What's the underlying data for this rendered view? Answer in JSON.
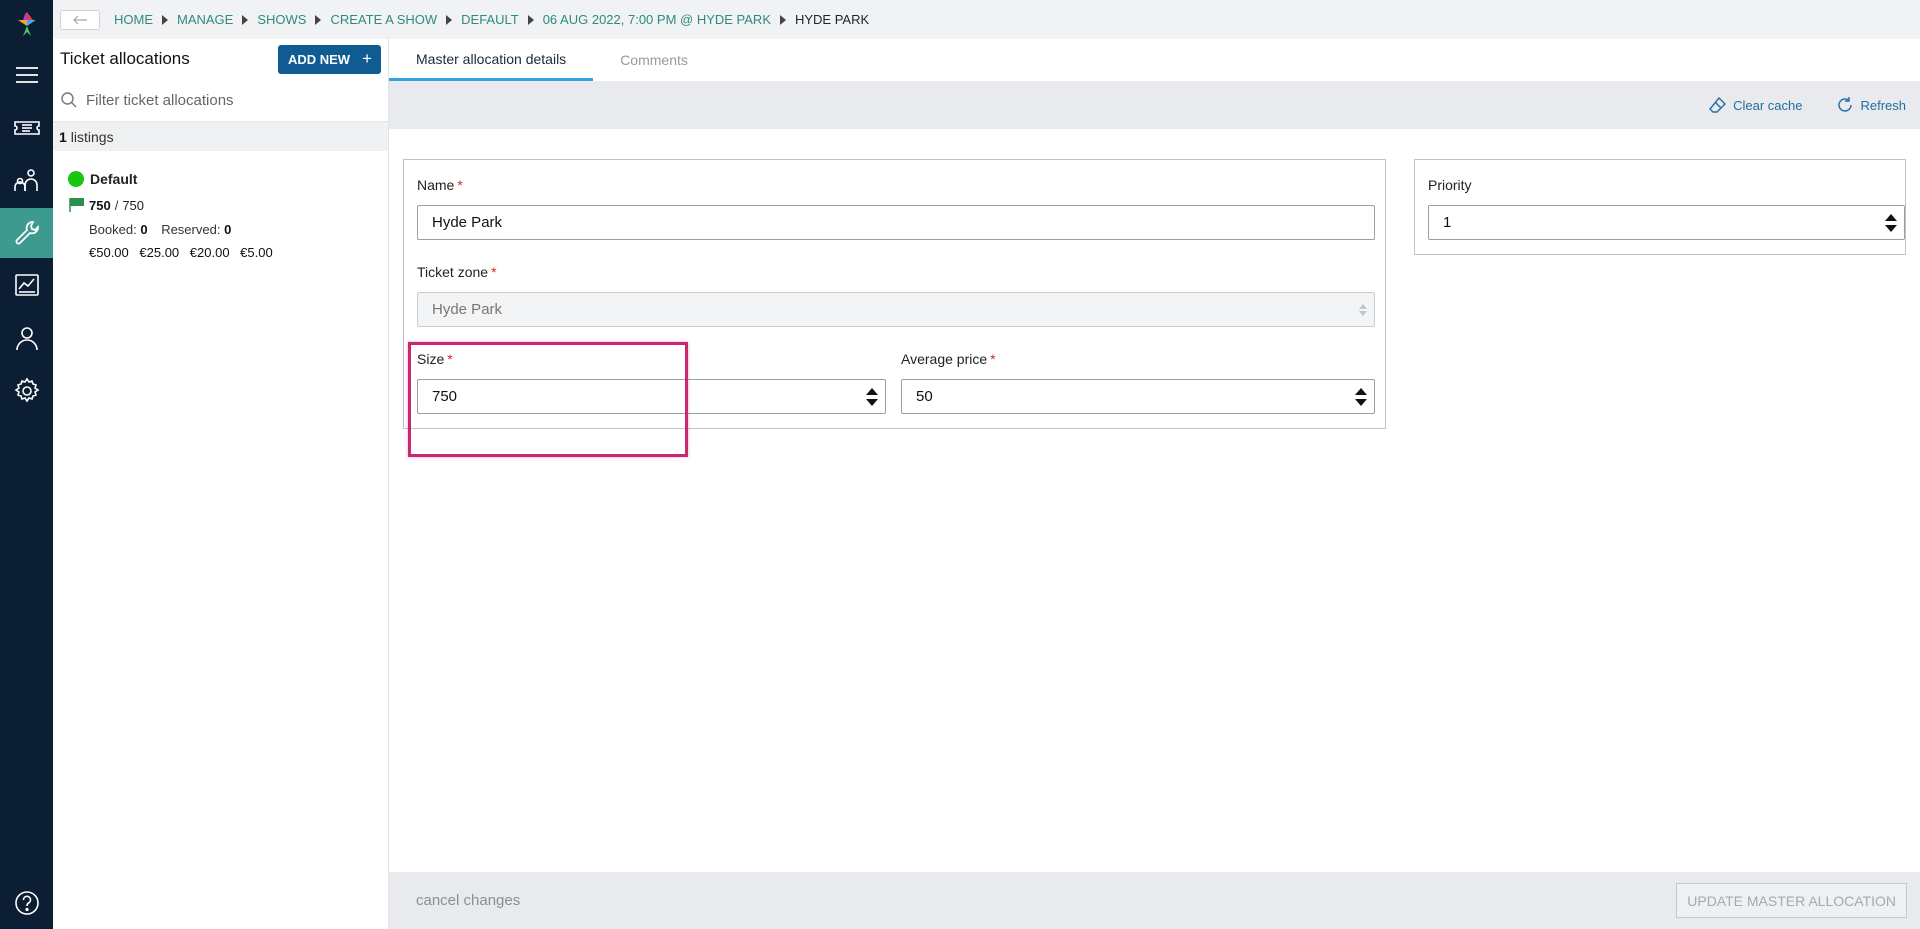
{
  "breadcrumb": {
    "items": [
      "HOME",
      "MANAGE",
      "SHOWS",
      "CREATE A SHOW",
      "DEFAULT",
      "06 AUG 2022, 7:00 PM @ HYDE PARK"
    ],
    "current": "HYDE PARK"
  },
  "sidebar": {
    "title": "Ticket allocations",
    "add_new_label": "ADD NEW",
    "filter_placeholder": "Filter ticket allocations",
    "listings_count": "1",
    "listings_label": "listings",
    "allocation": {
      "name": "Default",
      "status_color": "#17c60e",
      "available": "750",
      "capacity_separator": "/",
      "total": "750",
      "booked_label": "Booked:",
      "booked_value": "0",
      "reserved_label": "Reserved:",
      "reserved_value": "0",
      "prices": [
        "€50.00",
        "€25.00",
        "€20.00",
        "€5.00"
      ]
    }
  },
  "main": {
    "tabs": [
      {
        "label": "Master allocation details",
        "active": true
      },
      {
        "label": "Comments",
        "active": false
      }
    ],
    "toolbar": {
      "clear_cache_label": "Clear cache",
      "refresh_label": "Refresh"
    },
    "form": {
      "name_label": "Name",
      "name_value": "Hyde Park",
      "ticket_zone_label": "Ticket zone",
      "ticket_zone_value": "Hyde Park",
      "size_label": "Size",
      "size_value": "750",
      "average_price_label": "Average price",
      "average_price_value": "50",
      "priority_label": "Priority",
      "priority_value": "1",
      "required_marker": "*"
    }
  },
  "footer": {
    "cancel_label": "cancel changes",
    "update_label": "UPDATE MASTER ALLOCATION"
  },
  "colors": {
    "rail_bg": "#0b1e33",
    "rail_active": "#3c9a8f",
    "primary_button": "#0e5c92",
    "link": "#1f6fa6",
    "breadcrumb_link": "#2e8b7e",
    "tab_underline": "#37a0e0",
    "highlight": "#c8286f"
  }
}
